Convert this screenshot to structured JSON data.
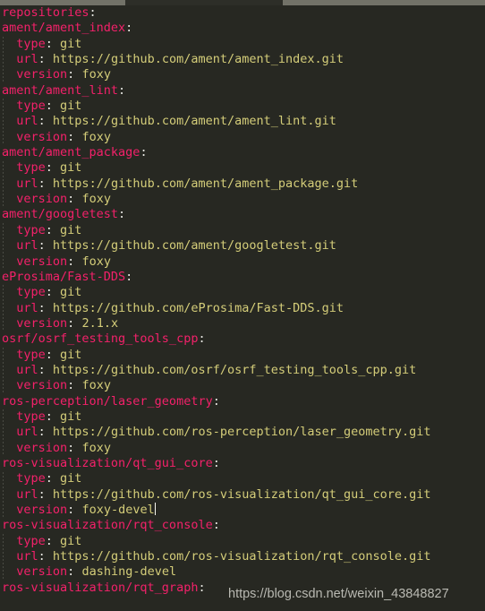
{
  "window": {
    "chrome": {
      "left_segment_label": "tab-strip-left",
      "right_segment_label": "tab-strip-right"
    }
  },
  "editor": {
    "language": "yaml",
    "colors": {
      "background": "#272822",
      "key": "#f3216a",
      "value": "#d4cd79",
      "punctuation": "#e7e6e1",
      "caret": "#f8f8f0",
      "indent_guide": "#4a4b44"
    },
    "cursor": {
      "line": 37,
      "after_text": "foxy-devel"
    },
    "lines": [
      {
        "indent": "",
        "key": "repositories",
        "colon": ":",
        "value": ""
      },
      {
        "indent": "",
        "key": "ament/ament_index",
        "colon": ":",
        "value": ""
      },
      {
        "indent": "  ",
        "key": "type",
        "colon": ":",
        "value": " git"
      },
      {
        "indent": "  ",
        "key": "url",
        "colon": ":",
        "value": " https://github.com/ament/ament_index.git"
      },
      {
        "indent": "  ",
        "key": "version",
        "colon": ":",
        "value": " foxy"
      },
      {
        "indent": "",
        "key": "ament/ament_lint",
        "colon": ":",
        "value": ""
      },
      {
        "indent": "  ",
        "key": "type",
        "colon": ":",
        "value": " git"
      },
      {
        "indent": "  ",
        "key": "url",
        "colon": ":",
        "value": " https://github.com/ament/ament_lint.git"
      },
      {
        "indent": "  ",
        "key": "version",
        "colon": ":",
        "value": " foxy"
      },
      {
        "indent": "",
        "key": "ament/ament_package",
        "colon": ":",
        "value": ""
      },
      {
        "indent": "  ",
        "key": "type",
        "colon": ":",
        "value": " git"
      },
      {
        "indent": "  ",
        "key": "url",
        "colon": ":",
        "value": " https://github.com/ament/ament_package.git"
      },
      {
        "indent": "  ",
        "key": "version",
        "colon": ":",
        "value": " foxy"
      },
      {
        "indent": "",
        "key": "ament/googletest",
        "colon": ":",
        "value": ""
      },
      {
        "indent": "  ",
        "key": "type",
        "colon": ":",
        "value": " git"
      },
      {
        "indent": "  ",
        "key": "url",
        "colon": ":",
        "value": " https://github.com/ament/googletest.git"
      },
      {
        "indent": "  ",
        "key": "version",
        "colon": ":",
        "value": " foxy"
      },
      {
        "indent": "",
        "key": "eProsima/Fast-DDS",
        "colon": ":",
        "value": ""
      },
      {
        "indent": "  ",
        "key": "type",
        "colon": ":",
        "value": " git"
      },
      {
        "indent": "  ",
        "key": "url",
        "colon": ":",
        "value": " https://github.com/eProsima/Fast-DDS.git"
      },
      {
        "indent": "  ",
        "key": "version",
        "colon": ":",
        "value": " 2.1.x"
      },
      {
        "indent": "",
        "key": "osrf/osrf_testing_tools_cpp",
        "colon": ":",
        "value": ""
      },
      {
        "indent": "  ",
        "key": "type",
        "colon": ":",
        "value": " git"
      },
      {
        "indent": "  ",
        "key": "url",
        "colon": ":",
        "value": " https://github.com/osrf/osrf_testing_tools_cpp.git"
      },
      {
        "indent": "  ",
        "key": "version",
        "colon": ":",
        "value": " foxy"
      },
      {
        "indent": "",
        "key": "ros-perception/laser_geometry",
        "colon": ":",
        "value": ""
      },
      {
        "indent": "  ",
        "key": "type",
        "colon": ":",
        "value": " git"
      },
      {
        "indent": "  ",
        "key": "url",
        "colon": ":",
        "value": " https://github.com/ros-perception/laser_geometry.git"
      },
      {
        "indent": "  ",
        "key": "version",
        "colon": ":",
        "value": " foxy"
      },
      {
        "indent": "",
        "key": "ros-visualization/qt_gui_core",
        "colon": ":",
        "value": ""
      },
      {
        "indent": "  ",
        "key": "type",
        "colon": ":",
        "value": " git"
      },
      {
        "indent": "  ",
        "key": "url",
        "colon": ":",
        "value": " https://github.com/ros-visualization/qt_gui_core.git"
      },
      {
        "indent": "  ",
        "key": "version",
        "colon": ":",
        "value": " foxy-devel",
        "caret": true
      },
      {
        "indent": "",
        "key": "ros-visualization/rqt_console",
        "colon": ":",
        "value": ""
      },
      {
        "indent": "  ",
        "key": "type",
        "colon": ":",
        "value": " git"
      },
      {
        "indent": "  ",
        "key": "url",
        "colon": ":",
        "value": " https://github.com/ros-visualization/rqt_console.git"
      },
      {
        "indent": "  ",
        "key": "version",
        "colon": ":",
        "value": " dashing-devel"
      },
      {
        "indent": "",
        "key": "ros-visualization/rqt_graph",
        "colon": ":",
        "value": ""
      }
    ]
  },
  "watermark": {
    "text": "https://blog.csdn.net/weixin_43848827"
  }
}
